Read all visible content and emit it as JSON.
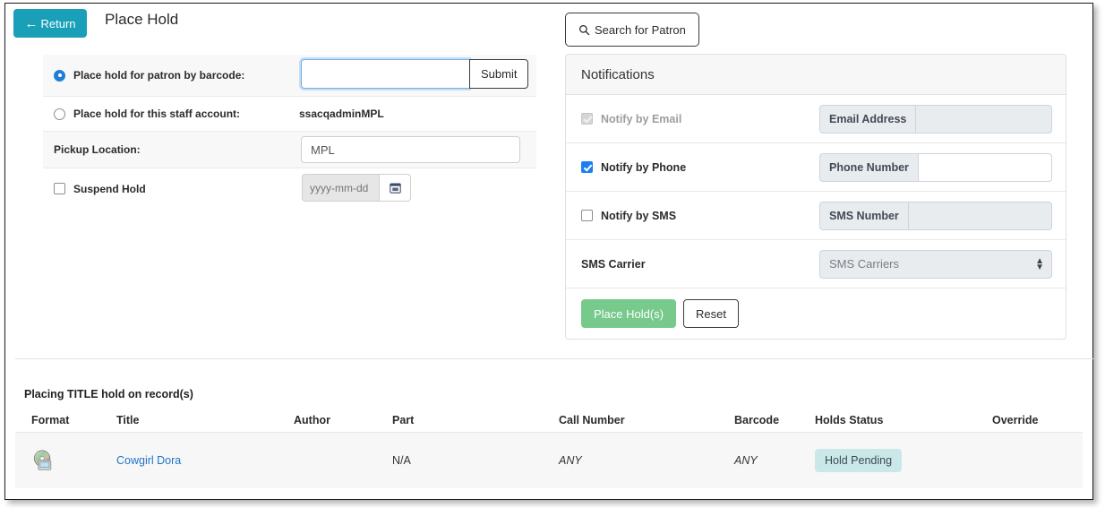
{
  "header": {
    "return_label": "Return",
    "return_icon": "arrow-left-icon",
    "title": "Place Hold",
    "return_bg": "#19a0b8"
  },
  "patron_form": {
    "barcode_row": {
      "label": "Place hold for patron by barcode:",
      "radio_selected": true,
      "input_value": "",
      "input_placeholder": "",
      "submit_label": "Submit"
    },
    "staff_row": {
      "label": "Place hold for this staff account:",
      "radio_selected": false,
      "account": "ssacqadminMPL"
    },
    "pickup_row": {
      "label": "Pickup Location:",
      "value": "MPL"
    },
    "suspend_row": {
      "label": "Suspend Hold",
      "checked": false,
      "date_placeholder": "yyyy-mm-dd",
      "date_value": "",
      "calendar_icon": "calendar-icon"
    }
  },
  "search_patron": {
    "label": "Search for Patron",
    "icon": "search-icon"
  },
  "notifications": {
    "title": "Notifications",
    "rows": [
      {
        "label": "Notify by Email",
        "checked": true,
        "disabled": true,
        "addon": "Email Address",
        "value": "",
        "field_disabled": true
      },
      {
        "label": "Notify by Phone",
        "checked": true,
        "disabled": false,
        "addon": "Phone Number",
        "value": "",
        "field_disabled": false
      },
      {
        "label": "Notify by SMS",
        "checked": false,
        "disabled": false,
        "addon": "SMS Number",
        "value": "",
        "field_disabled": true
      }
    ],
    "carrier": {
      "label": "SMS Carrier",
      "selected": "SMS Carriers",
      "disabled": true
    },
    "actions": {
      "place_label": "Place Hold(s)",
      "reset_label": "Reset",
      "place_bg": "#77c98c"
    }
  },
  "records": {
    "caption": "Placing TITLE hold on record(s)",
    "columns": [
      "Format",
      "Title",
      "Author",
      "Part",
      "Call Number",
      "Barcode",
      "Holds Status",
      "Override"
    ],
    "rows": [
      {
        "format_icon": "dvd-format-icon",
        "title": "Cowgirl Dora",
        "author": "",
        "part": "N/A",
        "call_number": "ANY",
        "barcode": "ANY",
        "holds_status": "Hold Pending",
        "override": "",
        "status_bg": "#cbe8e9"
      }
    ]
  }
}
